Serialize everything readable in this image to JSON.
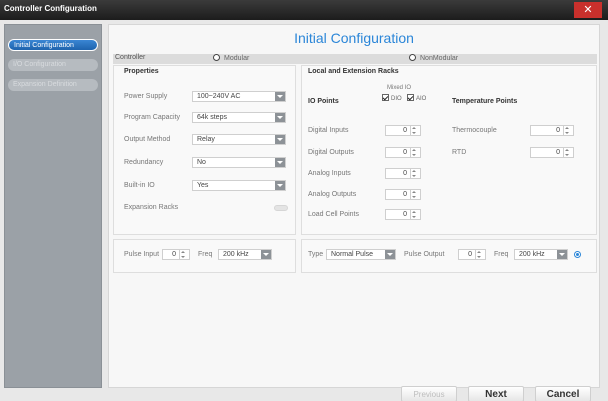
{
  "window": {
    "title": "Controller Configuration",
    "close_glyph": "✕"
  },
  "sidebar": {
    "items": [
      {
        "label": "Initial Configuration",
        "active": true
      },
      {
        "label": "I/O Configuration",
        "active": false
      },
      {
        "label": "Expansion Definition",
        "active": false
      }
    ]
  },
  "main": {
    "heading": "Initial Configuration",
    "controller_label": "Controller",
    "modular_label": "Modular",
    "nonmodular_label": "NonModular"
  },
  "properties": {
    "title": "Properties",
    "power_supply": {
      "label": "Power Supply",
      "value": "100~240V AC"
    },
    "program_capacity": {
      "label": "Program Capacity",
      "value": "64k steps"
    },
    "output_method": {
      "label": "Output Method",
      "value": "Relay"
    },
    "redundancy": {
      "label": "Redundancy",
      "value": "No"
    },
    "built_in_io": {
      "label": "Built-in IO",
      "value": "Yes"
    },
    "expansion_racks": {
      "label": "Expansion Racks"
    }
  },
  "racks": {
    "title": "Local and Extension Racks",
    "io_points_label": "IO Points",
    "mixed_io_label": "Mixed IO",
    "dio_label": "DIO",
    "aio_label": "AIO",
    "temperature_points_label": "Temperature Points",
    "digital_inputs": {
      "label": "Digital Inputs",
      "value": "0"
    },
    "digital_outputs": {
      "label": "Digital Outputs",
      "value": "0"
    },
    "analog_inputs": {
      "label": "Analog Inputs",
      "value": "0"
    },
    "analog_outputs": {
      "label": "Analog Outputs",
      "value": "0"
    },
    "load_cell_points": {
      "label": "Load Cell Points",
      "value": "0"
    },
    "thermocouple": {
      "label": "Thermocouple",
      "value": "0"
    },
    "rtd": {
      "label": "RTD",
      "value": "0"
    }
  },
  "pulse": {
    "pulse_input_label": "Pulse Input",
    "pulse_input_value": "0",
    "freq_label": "Freq",
    "freq_value": "200 kHz",
    "type_label": "Type",
    "type_value": "Normal Pulse",
    "pulse_output_label": "Pulse Output",
    "pulse_output_value": "0",
    "freq2_label": "Freq",
    "freq2_value": "200 kHz"
  },
  "footer": {
    "previous": "Previous",
    "next": "Next",
    "cancel": "Cancel"
  }
}
